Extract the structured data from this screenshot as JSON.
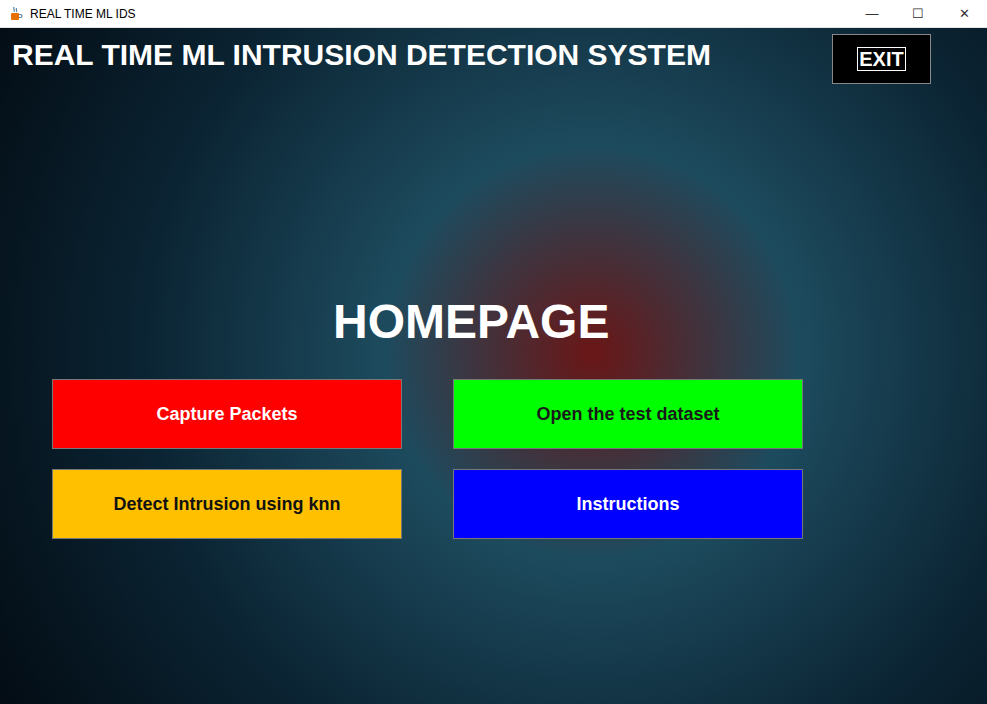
{
  "window": {
    "title": "REAL TIME ML IDS",
    "controls": [
      "—",
      "☐",
      "✕"
    ]
  },
  "header": {
    "title": "REAL TIME ML INTRUSION DETECTION SYSTEM",
    "exit_button": "EXIT"
  },
  "page_title": "HOMEPAGE",
  "buttons": [
    {
      "label": "Capture Packets",
      "color": "#ff0000",
      "text_color": "#ffffff"
    },
    {
      "label": "Open the test dataset",
      "color": "#00ff00",
      "text_color": "#1a1a1a"
    },
    {
      "label": "Detect Intrusion using knn",
      "color": "#ffc000",
      "text_color": "#111111"
    },
    {
      "label": "Instructions",
      "color": "#0000ff",
      "text_color": "#ffffff"
    }
  ]
}
